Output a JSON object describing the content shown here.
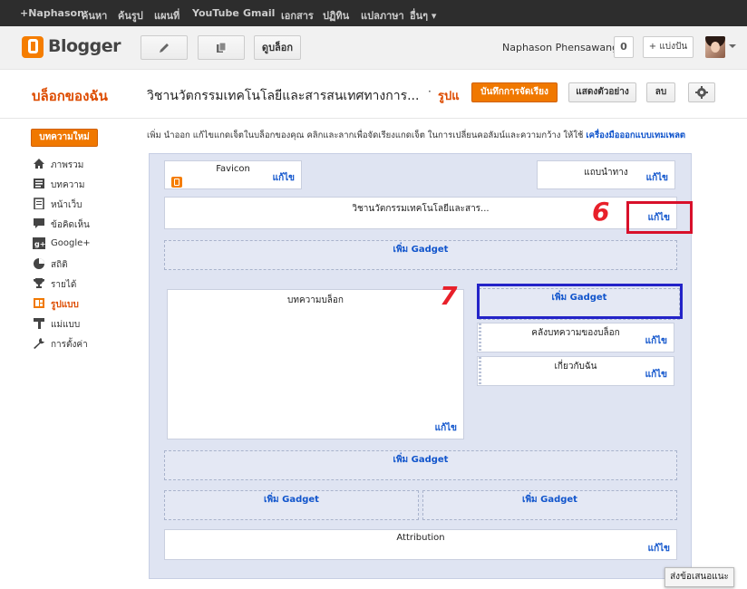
{
  "google_bar": {
    "items": [
      "+Naphason",
      "ค้นหา",
      "ค้นรูป",
      "แผนที่",
      "YouTube",
      "Gmail",
      "เอกสาร",
      "ปฏิทิน",
      "แปลภาษา",
      "อื่นๆ ▾"
    ]
  },
  "header": {
    "logo_text": "Blogger",
    "new_post_icon": "pencil-icon",
    "pages_icon": "pages-icon",
    "view_blog_label": "ดูบล็อก",
    "username": "Naphason Phensawang",
    "notifications": "0",
    "share_label": "+ แบ่งปัน"
  },
  "subheader": {
    "my_blog": "บล็อกของฉัน",
    "blog_title": "วิชานวัตกรรมเทคโนโลยีและสารสนเทศทางการ...",
    "separator": "·",
    "breadcrumb": "รูปแ",
    "save_arrangement": "บันทึกการจัดเรียง",
    "preview": "แสดงตัวอย่าง",
    "clear": "ลบ",
    "settings_icon": "gear-icon"
  },
  "sidebar": {
    "new_post": "บทความใหม่",
    "items": [
      {
        "label": "ภาพรวม",
        "icon": "home-icon"
      },
      {
        "label": "บทความ",
        "icon": "posts-icon"
      },
      {
        "label": "หน้าเว็บ",
        "icon": "pages-icon"
      },
      {
        "label": "ข้อคิดเห็น",
        "icon": "comment-icon"
      },
      {
        "label": "Google+",
        "icon": "google-plus-icon"
      },
      {
        "label": "สถิติ",
        "icon": "pie-chart-icon"
      },
      {
        "label": "รายได้",
        "icon": "trophy-icon"
      },
      {
        "label": "รูปแบบ",
        "icon": "layout-icon"
      },
      {
        "label": "แม่แบบ",
        "icon": "template-icon"
      },
      {
        "label": "การตั้งค่า",
        "icon": "wrench-icon"
      }
    ]
  },
  "description": {
    "text": "เพิ่ม นำออก แก้ไขแกดเจ็ตในบล็อกของคุณ คลิกและลากเพื่อจัดเรียงแกดเจ็ต ในการเปลี่ยนคอลัมน์และความกว้าง ให้ใช้ ",
    "link": "เครื่องมือออกแบบเทมเพลต"
  },
  "layout": {
    "edit_label": "แก้ไข",
    "add_gadget": "เพิ่ม Gadget",
    "favicon": "Favicon",
    "navbar": "แถบนำทาง",
    "header_gadget": "วิชานวัตกรรมเทคโนโลยีและสาร...",
    "main_posts": "บทความบล็อก",
    "archive": "คลังบทความของบล็อก",
    "about_me": "เกี่ยวกับฉัน",
    "attribution": "Attribution"
  },
  "annotations": {
    "six": "6",
    "seven": "7",
    "highlight_edit_color": "#d8102a",
    "highlight_gadget_color": "#2323c8"
  },
  "feedback": "ส่งข้อเสนอแนะ"
}
